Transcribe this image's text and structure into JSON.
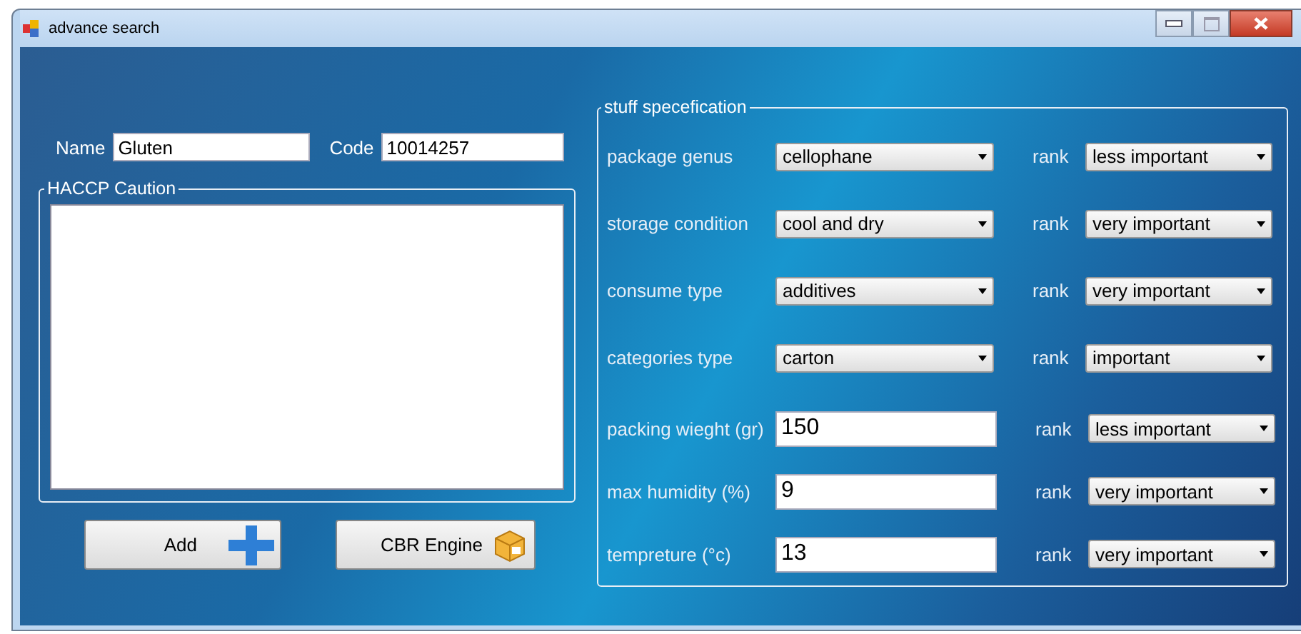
{
  "window": {
    "title": "advance search"
  },
  "name": {
    "label": "Name",
    "value": "Gluten"
  },
  "code": {
    "label": "Code",
    "value": "10014257"
  },
  "haccp": {
    "legend": "HACCP Caution"
  },
  "buttons": [
    {
      "label": "Add",
      "kind": "add"
    },
    {
      "label": "CBR Engine",
      "kind": "engine"
    }
  ],
  "spec": {
    "legend": "stuff specefication",
    "rows": [
      {
        "label": "package genus",
        "kind": "select",
        "value": "cellophane",
        "rank_label": "rank",
        "rank": "less important"
      },
      {
        "label": "storage condition",
        "kind": "select",
        "value": "cool and dry",
        "rank_label": "rank",
        "rank": "very important"
      },
      {
        "label": "consume type",
        "kind": "select",
        "value": "additives",
        "rank_label": "rank",
        "rank": "very important"
      },
      {
        "label": "categories type",
        "kind": "select",
        "value": "carton",
        "rank_label": "rank",
        "rank": "important"
      },
      {
        "label": "packing wieght (gr)",
        "kind": "input",
        "value": "150",
        "rank_label": "rank",
        "rank": "less important"
      },
      {
        "label": "max humidity (%)",
        "kind": "input",
        "value": "9",
        "rank_label": "rank",
        "rank": "very important"
      },
      {
        "label": "tempreture (°c)",
        "kind": "input",
        "value": "13",
        "rank_label": "rank",
        "rank": "very important"
      }
    ]
  }
}
